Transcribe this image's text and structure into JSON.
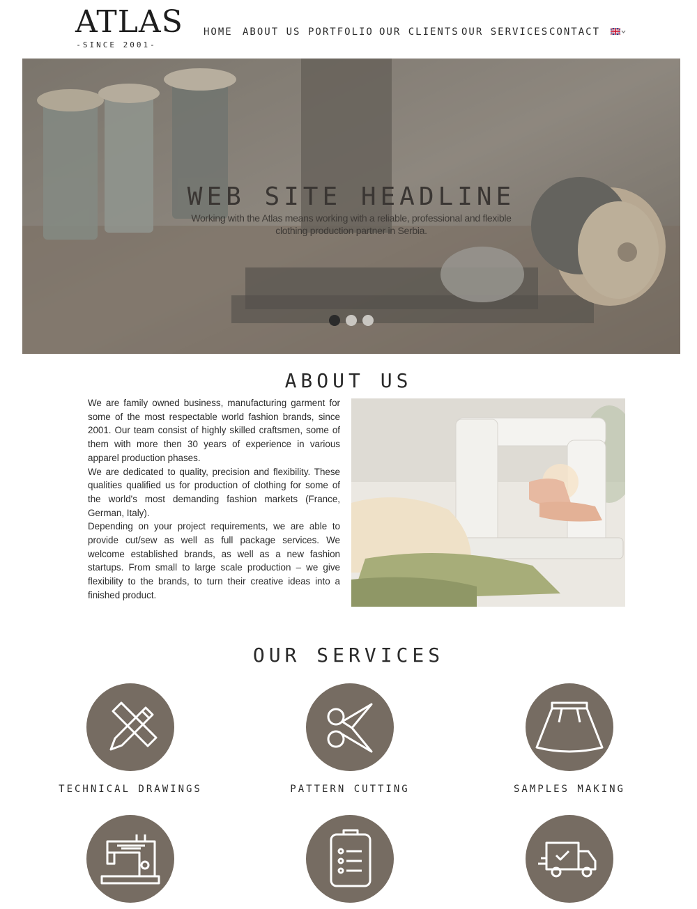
{
  "brand": {
    "logo_text": "ATLAS",
    "since_text": "-SINCE 2001-"
  },
  "nav": {
    "items": [
      {
        "label": "HOME"
      },
      {
        "label": "ABOUT US"
      },
      {
        "label": "PORTFOLIO"
      },
      {
        "label": "OUR CLIENTS"
      },
      {
        "label": "OUR SERVICES"
      },
      {
        "label": "CONTACT"
      }
    ],
    "language_flag": "uk-flag-icon"
  },
  "hero": {
    "headline": "WEB SITE HEADLINE",
    "subtitle": "Working with the Atlas means working with a reliable, professional and flexible clothing production partner in Serbia.",
    "slides_total": 3,
    "active_slide": 1
  },
  "about": {
    "title": "ABOUT US",
    "paragraphs": [
      "We are family owned business, manufacturing garment for some of the most respectable world fashion brands, since 2001. Our team consist of highly skilled craftsmen, some of them with more then 30 years of experience in various apparel production phases.",
      "We are dedicated to quality, precision and flexibility. These qualities qualified us for production of clothing for some of the world's most demanding fashion markets (France, German, Italy).",
      "Depending on your project requirements, we are able to provide cut/sew as well as full package services. We welcome established brands, as well as a new fashion startups. From small to large scale production – we give flexibility to the brands, to turn their creative ideas into a finished product."
    ]
  },
  "services": {
    "title": "OUR SERVICES",
    "items": [
      {
        "label": "TECHNICAL DRAWINGS",
        "icon": "pencil-ruler-icon"
      },
      {
        "label": "PATTERN CUTTING",
        "icon": "scissors-icon"
      },
      {
        "label": "SAMPLES MAKING",
        "icon": "skirt-icon"
      },
      {
        "label": "",
        "icon": "sewing-machine-icon"
      },
      {
        "label": "",
        "icon": "clipboard-checklist-icon"
      },
      {
        "label": "",
        "icon": "delivery-truck-icon"
      }
    ]
  },
  "colors": {
    "service_circle": "#766c62",
    "text": "#2a2a2a",
    "dot_active": "#2b2b2b",
    "dot_inactive": "#c9c6c1"
  }
}
